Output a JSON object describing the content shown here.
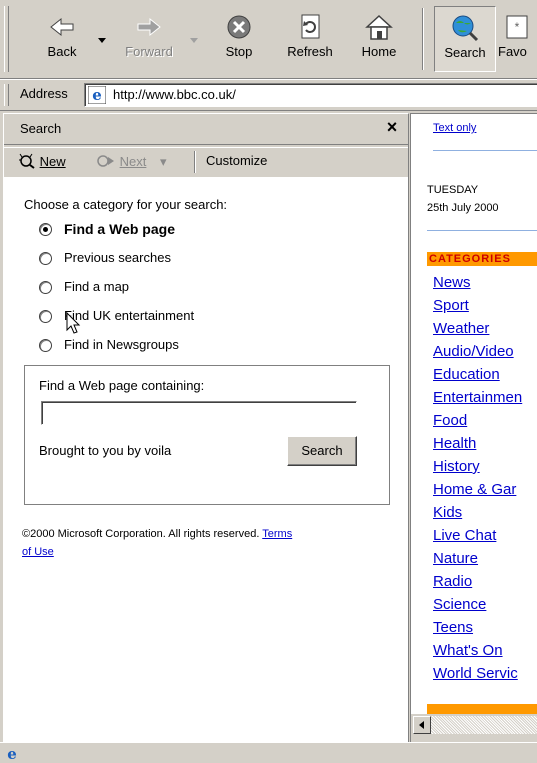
{
  "toolbar": {
    "back": "Back",
    "forward": "Forward",
    "stop": "Stop",
    "refresh": "Refresh",
    "home": "Home",
    "search": "Search",
    "favorites": "Favo"
  },
  "address": {
    "label": "Address",
    "url": "http://www.bbc.co.uk/"
  },
  "search_pane": {
    "title": "Search",
    "close": "×",
    "new_label": "New",
    "next_label": "Next",
    "customize_label": "Customize",
    "prompt": "Choose a category for your search:",
    "options": [
      {
        "label": "Find a Web page",
        "selected": true
      },
      {
        "label": "Previous searches",
        "selected": false
      },
      {
        "label": "Find a map",
        "selected": false
      },
      {
        "label": "Find UK entertainment",
        "selected": false
      },
      {
        "label": "Find in Newsgroups",
        "selected": false
      }
    ],
    "find_label": "Find a Web page containing:",
    "find_value": "",
    "provider": "Brought to you by voila",
    "search_button": "Search",
    "copyright": "©2000 Microsoft Corporation. All rights reserved.",
    "terms_line1": "Terms",
    "terms_line2": "of Use"
  },
  "bbc": {
    "text_only": "Text only",
    "day": "TUESDAY",
    "date": "25th July 2000",
    "categories_heading": "CATEGORIES",
    "links": [
      "News",
      "Sport",
      "Weather",
      "Audio/Video",
      "Education",
      "Entertainmen",
      "Food",
      "Health",
      "History",
      "Home & Gar",
      "Kids",
      "Live Chat",
      "Nature",
      "Radio",
      "Science",
      "Teens",
      "What's On",
      "World Servic"
    ]
  },
  "colors": {
    "chrome": "#d4d0c8",
    "link": "#0000cc",
    "category_bar": "#ff9900"
  }
}
